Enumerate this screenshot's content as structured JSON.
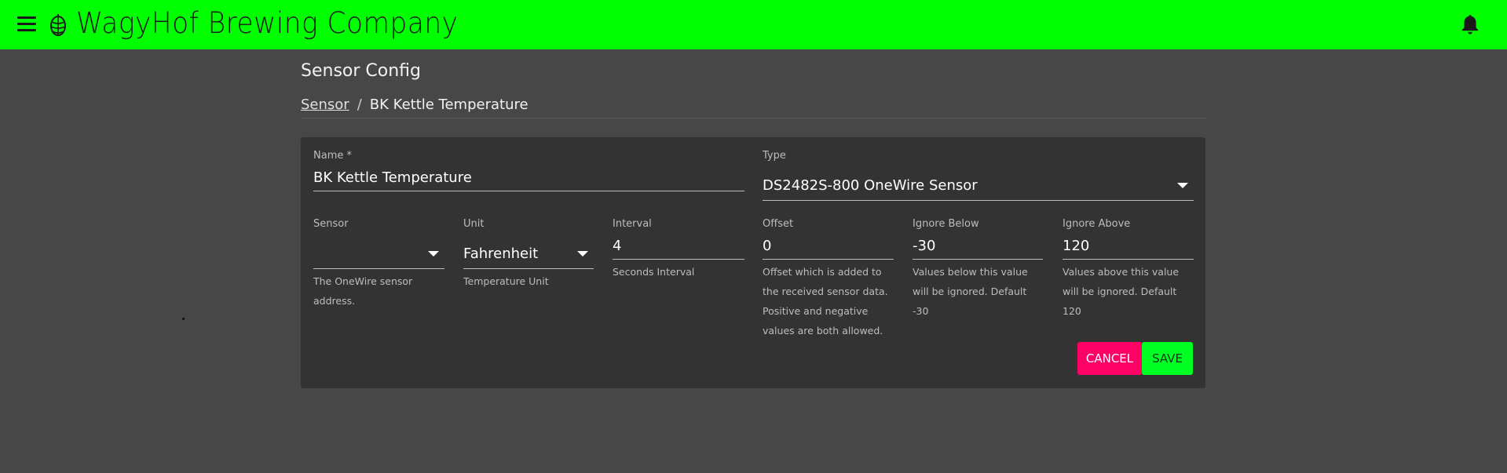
{
  "app": {
    "title": "WagyHof Brewing Company"
  },
  "page": {
    "title": "Sensor Config",
    "breadcrumb": {
      "parent": "Sensor",
      "current": "BK Kettle Temperature"
    }
  },
  "form": {
    "name": {
      "label": "Name *",
      "value": "BK Kettle Temperature"
    },
    "type": {
      "label": "Type",
      "value": "DS2482S-800 OneWire Sensor"
    },
    "sensor": {
      "label": "Sensor",
      "value": "",
      "hint": "The OneWire sensor address."
    },
    "unit": {
      "label": "Unit",
      "value": "Fahrenheit",
      "hint": "Temperature Unit"
    },
    "interval": {
      "label": "Interval",
      "value": "4",
      "hint": "Seconds Interval"
    },
    "offset": {
      "label": "Offset",
      "value": "0",
      "hint": "Offset which is added to the received sensor data. Positive and negative values are both allowed."
    },
    "ignore_below": {
      "label": "Ignore Below",
      "value": "-30",
      "hint": "Values below this value will be ignored. Default -30"
    },
    "ignore_above": {
      "label": "Ignore Above",
      "value": "120",
      "hint": "Values above this value will be ignored. Default 120"
    }
  },
  "actions": {
    "cancel_label": "CANCEL",
    "save_label": "SAVE"
  },
  "colors": {
    "topbar": "#00ff00",
    "cancel": "#ff0066",
    "save": "#00ff22",
    "background": "#474747",
    "card": "#333333"
  },
  "icons": {
    "menu": "menu-icon",
    "logo": "hop-icon",
    "notifications": "bell-icon"
  }
}
